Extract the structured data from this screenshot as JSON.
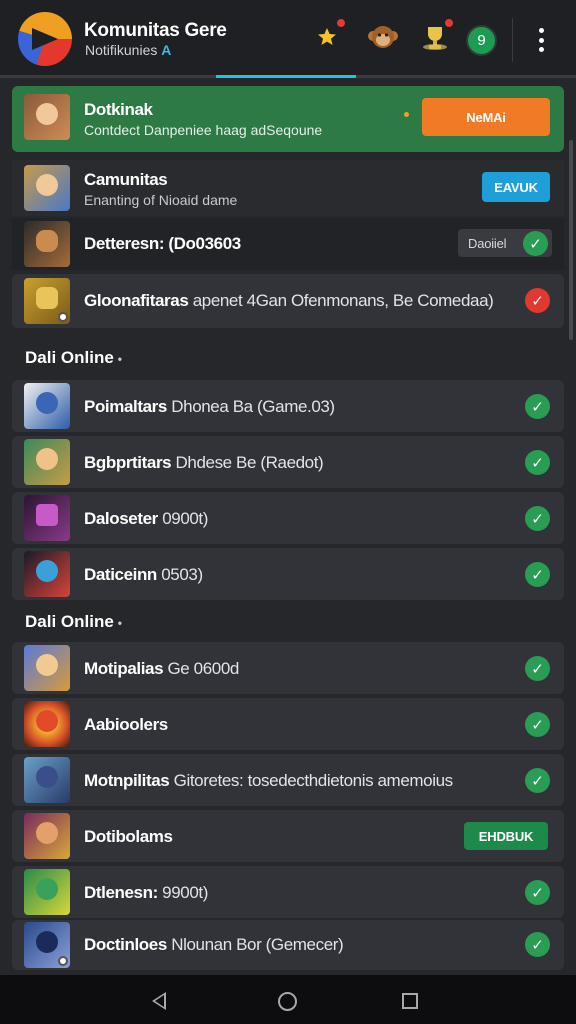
{
  "header": {
    "title": "Komunitas Gere",
    "subtitle": "Notifikunies",
    "subtitle_accent": "A",
    "counter": "9"
  },
  "featured": {
    "title": "Dotkinak",
    "subtitle": "Contdect Danpeniee haag adSeqoune",
    "button_label": "NeMAi"
  },
  "top_rows": [
    {
      "title": "Camunitas",
      "subtitle": "Enanting of Nioaid dame",
      "button_label": "EAVUK"
    },
    {
      "title": "Detteresn: (Do03603",
      "button_label": "Daoiiel"
    },
    {
      "title": "Gloonafitaras",
      "extra": " apenet 4Gan Ofenmonans, Be Comedaa)"
    }
  ],
  "sections": [
    {
      "title": "Dali Online",
      "items": [
        {
          "title": "Poimaltars",
          "extra": " Dhonea Ba (Game.03)"
        },
        {
          "title": "Bgbprtitars",
          "extra": " Dhdese Be (Raedot)"
        },
        {
          "title": "Daloseter",
          "extra": " 0900t)"
        },
        {
          "title": "Daticeinn",
          "extra": " 0503)"
        }
      ]
    },
    {
      "title": "Dali Online",
      "items": [
        {
          "title": "Motipalias",
          "extra": " Ge 0600d"
        },
        {
          "title": "Aabioolers",
          "extra": ""
        },
        {
          "title": "Motnpilitas",
          "extra": " Gitoretes: tosedecthdietonis amemoius"
        },
        {
          "title": "Dotibolams",
          "extra": "",
          "button_label": "EHDBUK"
        },
        {
          "title": "Dtlenesn:",
          "extra": " 9900t)"
        },
        {
          "title": "Doctinloes",
          "extra": " Nlounan Bor (Gemecer)"
        }
      ]
    }
  ],
  "colors": {
    "accent_teal": "#27c4d9",
    "featured_bg": "#2d7a45",
    "orange_button": "#f07a25",
    "blue_button": "#1e9fd8",
    "check_green": "#2a9d55",
    "check_red": "#e0392f"
  },
  "icons": {
    "star_notification": "star-icon",
    "monkey": "monkey-icon",
    "trophy": "trophy-icon",
    "check": "check-icon",
    "more": "kebab-menu-icon"
  }
}
